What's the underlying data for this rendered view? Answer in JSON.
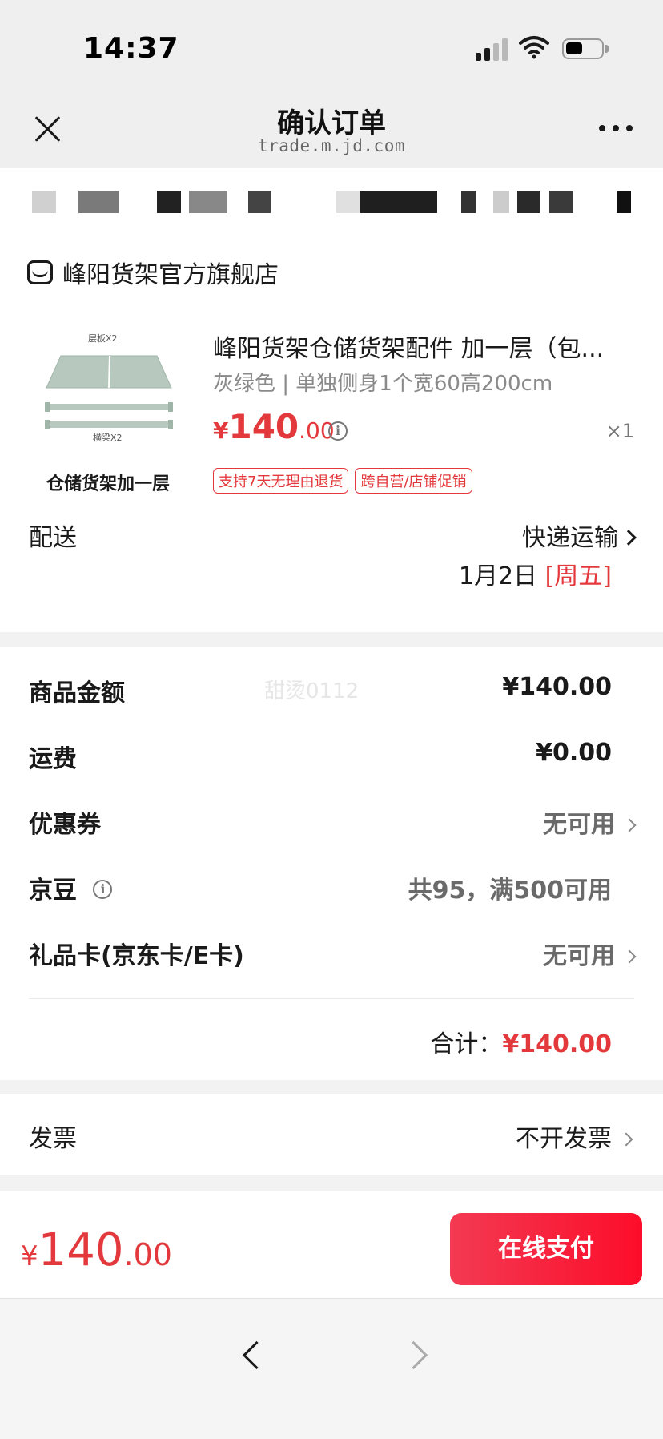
{
  "status_bar": {
    "time": "14:37"
  },
  "nav": {
    "title": "确认订单",
    "subtitle": "trade.m.jd.com"
  },
  "shop": {
    "name": "峰阳货架官方旗舰店"
  },
  "product": {
    "title": "峰阳货架仓储货架配件 加一层（包...",
    "spec": "灰绿色 | 单独侧身1个宽60高200cm",
    "price_symbol": "¥",
    "price_int": "140",
    "price_dec": ".00",
    "quantity": "×1",
    "image_label_top": "层板X2",
    "image_label_bottom": "横梁X2",
    "image_caption": "仓储货架加一层",
    "tags": [
      "支持7天无理由退货",
      "跨自营/店铺促销"
    ]
  },
  "delivery": {
    "label": "配送",
    "method": "快递运输",
    "date": "1月2日 ",
    "weekday": "[周五]"
  },
  "summary": {
    "watermark": "甜烫0112",
    "rows": [
      {
        "label": "商品金额",
        "value": "¥140.00"
      },
      {
        "label": "运费",
        "value": "¥0.00"
      },
      {
        "label": "优惠券",
        "value": "无可用"
      },
      {
        "label": "京豆",
        "value": "共95，满500可用"
      },
      {
        "label": "礼品卡(京东卡/E卡)",
        "value": "无可用"
      }
    ],
    "total_label": "合计：",
    "total_value": "¥140.00"
  },
  "invoice": {
    "label": "发票",
    "value": "不开发票"
  },
  "pay_bar": {
    "price_symbol": "¥",
    "price_int": "140",
    "price_dec": ".00",
    "button_label": "在线支付"
  },
  "colors": {
    "accent_red": "#e4393c",
    "pay_button": "#fc0d2a"
  },
  "icons": {
    "close": "close-icon",
    "more": "more-icon",
    "shop": "shop-icon",
    "info": "info-icon",
    "chevron": "chevron-right-icon",
    "back": "back-icon",
    "forward": "forward-icon"
  }
}
